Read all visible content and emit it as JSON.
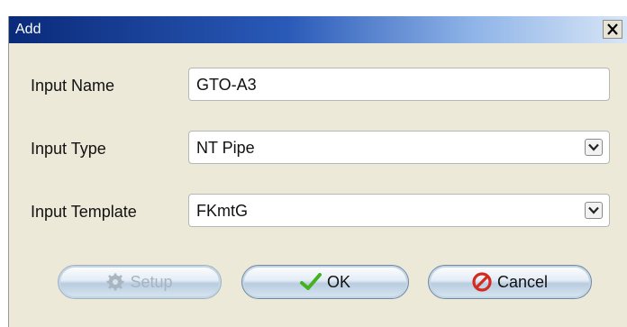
{
  "window": {
    "title": "Add"
  },
  "form": {
    "input_name": {
      "label": "Input Name",
      "value": "GTO-A3"
    },
    "input_type": {
      "label": "Input Type",
      "value": "NT Pipe"
    },
    "input_template": {
      "label": "Input Template",
      "value": "FKmtG"
    }
  },
  "buttons": {
    "setup": {
      "label": "Setup",
      "icon": "gear-icon",
      "enabled": false
    },
    "ok": {
      "label": "OK",
      "icon": "checkmark-icon"
    },
    "cancel": {
      "label": "Cancel",
      "icon": "no-entry-icon"
    }
  },
  "colors": {
    "title_bar_start": "#0a2a7a",
    "check_green": "#44b21f",
    "cancel_red": "#d42a1f"
  }
}
